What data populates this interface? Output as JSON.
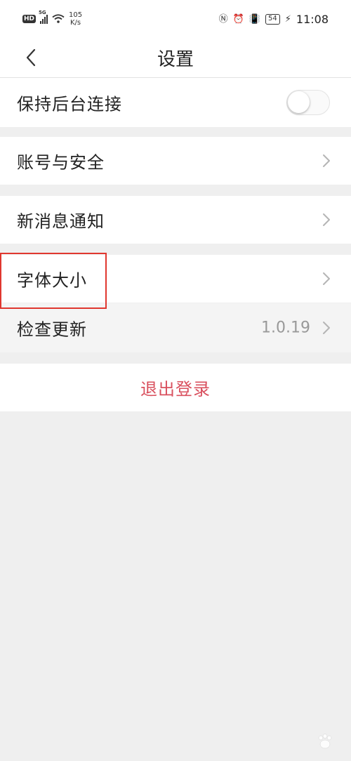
{
  "status_bar": {
    "hd": "HD",
    "network": "5G",
    "speed": "105",
    "speed_unit": "K/s",
    "battery": "54",
    "time": "11:08"
  },
  "header": {
    "title": "设置",
    "back_icon": "chevron-left-icon"
  },
  "settings": {
    "keep_alive_label": "保持后台连接",
    "keep_alive_enabled": false,
    "account_security_label": "账号与安全",
    "notifications_label": "新消息通知",
    "font_size_label": "字体大小",
    "check_update_label": "检查更新",
    "check_update_value": "1.0.19"
  },
  "logout": {
    "label": "退出登录"
  },
  "colors": {
    "accent_red": "#d9505e",
    "highlight_red": "#e0372f",
    "background": "#efefef"
  }
}
